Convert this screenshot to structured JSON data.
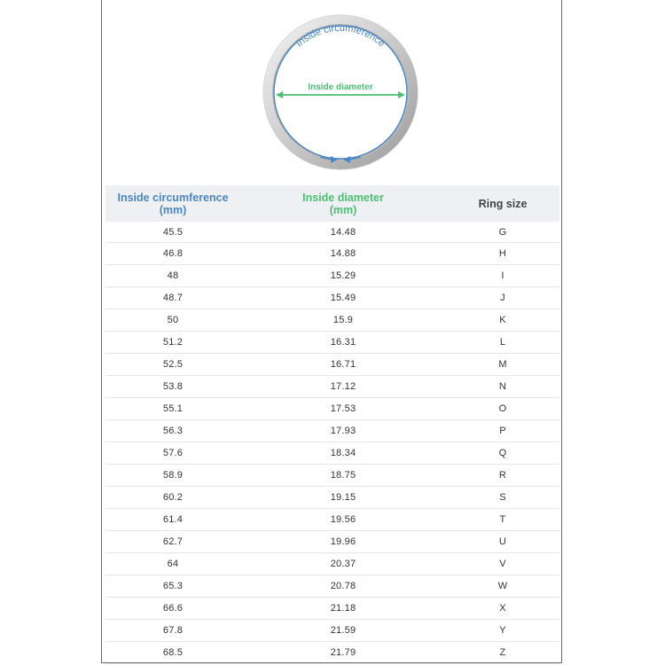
{
  "diagram": {
    "circumference_label": "Inside circumference",
    "diameter_label": "Inside diameter",
    "colors": {
      "circumference": "#4a86c5",
      "diameter": "#4cbf73",
      "ring": "#d9d9d9"
    }
  },
  "table": {
    "headers": {
      "circumference": [
        "Inside circumference",
        "(mm)"
      ],
      "diameter": [
        "Inside diameter",
        "(mm)"
      ],
      "size": "Ring size"
    },
    "rows": [
      {
        "circ": "45.5",
        "diam": "14.48",
        "size": "G"
      },
      {
        "circ": "46.8",
        "diam": "14.88",
        "size": "H"
      },
      {
        "circ": "48",
        "diam": "15.29",
        "size": "I"
      },
      {
        "circ": "48.7",
        "diam": "15.49",
        "size": "J"
      },
      {
        "circ": "50",
        "diam": "15.9",
        "size": "K"
      },
      {
        "circ": "51.2",
        "diam": "16.31",
        "size": "L"
      },
      {
        "circ": "52.5",
        "diam": "16.71",
        "size": "M"
      },
      {
        "circ": "53.8",
        "diam": "17.12",
        "size": "N"
      },
      {
        "circ": "55.1",
        "diam": "17.53",
        "size": "O"
      },
      {
        "circ": "56.3",
        "diam": "17.93",
        "size": "P"
      },
      {
        "circ": "57.6",
        "diam": "18.34",
        "size": "Q"
      },
      {
        "circ": "58.9",
        "diam": "18.75",
        "size": "R"
      },
      {
        "circ": "60.2",
        "diam": "19.15",
        "size": "S"
      },
      {
        "circ": "61.4",
        "diam": "19.56",
        "size": "T"
      },
      {
        "circ": "62.7",
        "diam": "19.96",
        "size": "U"
      },
      {
        "circ": "64",
        "diam": "20.37",
        "size": "V"
      },
      {
        "circ": "65.3",
        "diam": "20.78",
        "size": "W"
      },
      {
        "circ": "66.6",
        "diam": "21.18",
        "size": "X"
      },
      {
        "circ": "67.8",
        "diam": "21.59",
        "size": "Y"
      },
      {
        "circ": "68.5",
        "diam": "21.79",
        "size": "Z"
      }
    ]
  }
}
